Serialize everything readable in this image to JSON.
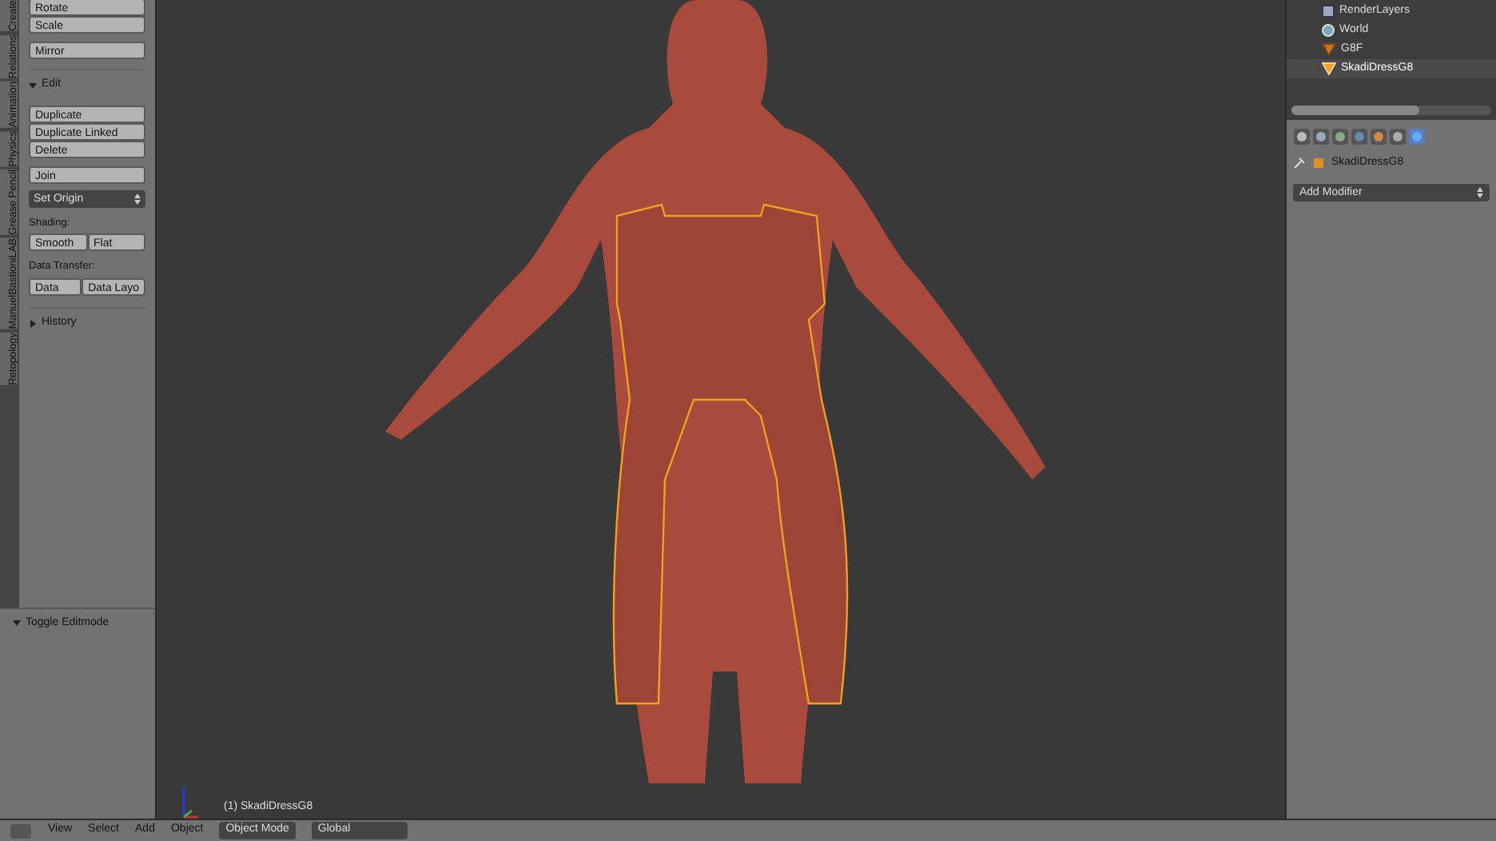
{
  "tool_tabs": [
    {
      "label": "Create"
    },
    {
      "label": "Relations"
    },
    {
      "label": "Animation"
    },
    {
      "label": "Physics"
    },
    {
      "label": "Grease Pencil"
    },
    {
      "label": "ManuelBastioniLAB"
    },
    {
      "label": "Retopology"
    }
  ],
  "toolbar": {
    "transform_buttons": [
      "Rotate",
      "Scale"
    ],
    "mirror": "Mirror",
    "edit_panel": {
      "title": "Edit",
      "expanded": true,
      "buttons": [
        "Duplicate",
        "Duplicate Linked",
        "Delete"
      ],
      "join": "Join",
      "set_origin": "Set Origin",
      "shading_label": "Shading:",
      "shading_buttons": [
        "Smooth",
        "Flat"
      ],
      "data_transfer_label": "Data Transfer:",
      "data_transfer_buttons": [
        "Data",
        "Data Layo"
      ]
    },
    "history": {
      "title": "History",
      "expanded": false
    }
  },
  "operator_panel": {
    "title": "Toggle Editmode",
    "expanded": true
  },
  "viewport": {
    "object_label": "(1) SkadiDressG8"
  },
  "outliner": {
    "items": [
      {
        "name": "RenderLayers",
        "kind": "renderlayers",
        "selected": false
      },
      {
        "name": "World",
        "kind": "world",
        "selected": false
      },
      {
        "name": "G8F",
        "kind": "mesh",
        "selected": false
      },
      {
        "name": "SkadiDressG8",
        "kind": "mesh",
        "selected": true
      }
    ]
  },
  "properties": {
    "breadcrumb": "SkadiDressG8",
    "add_modifier": "Add Modifier"
  },
  "header": {
    "menus": [
      "View",
      "Select",
      "Add",
      "Object"
    ],
    "mode": "Object Mode",
    "orientation": "Global"
  }
}
